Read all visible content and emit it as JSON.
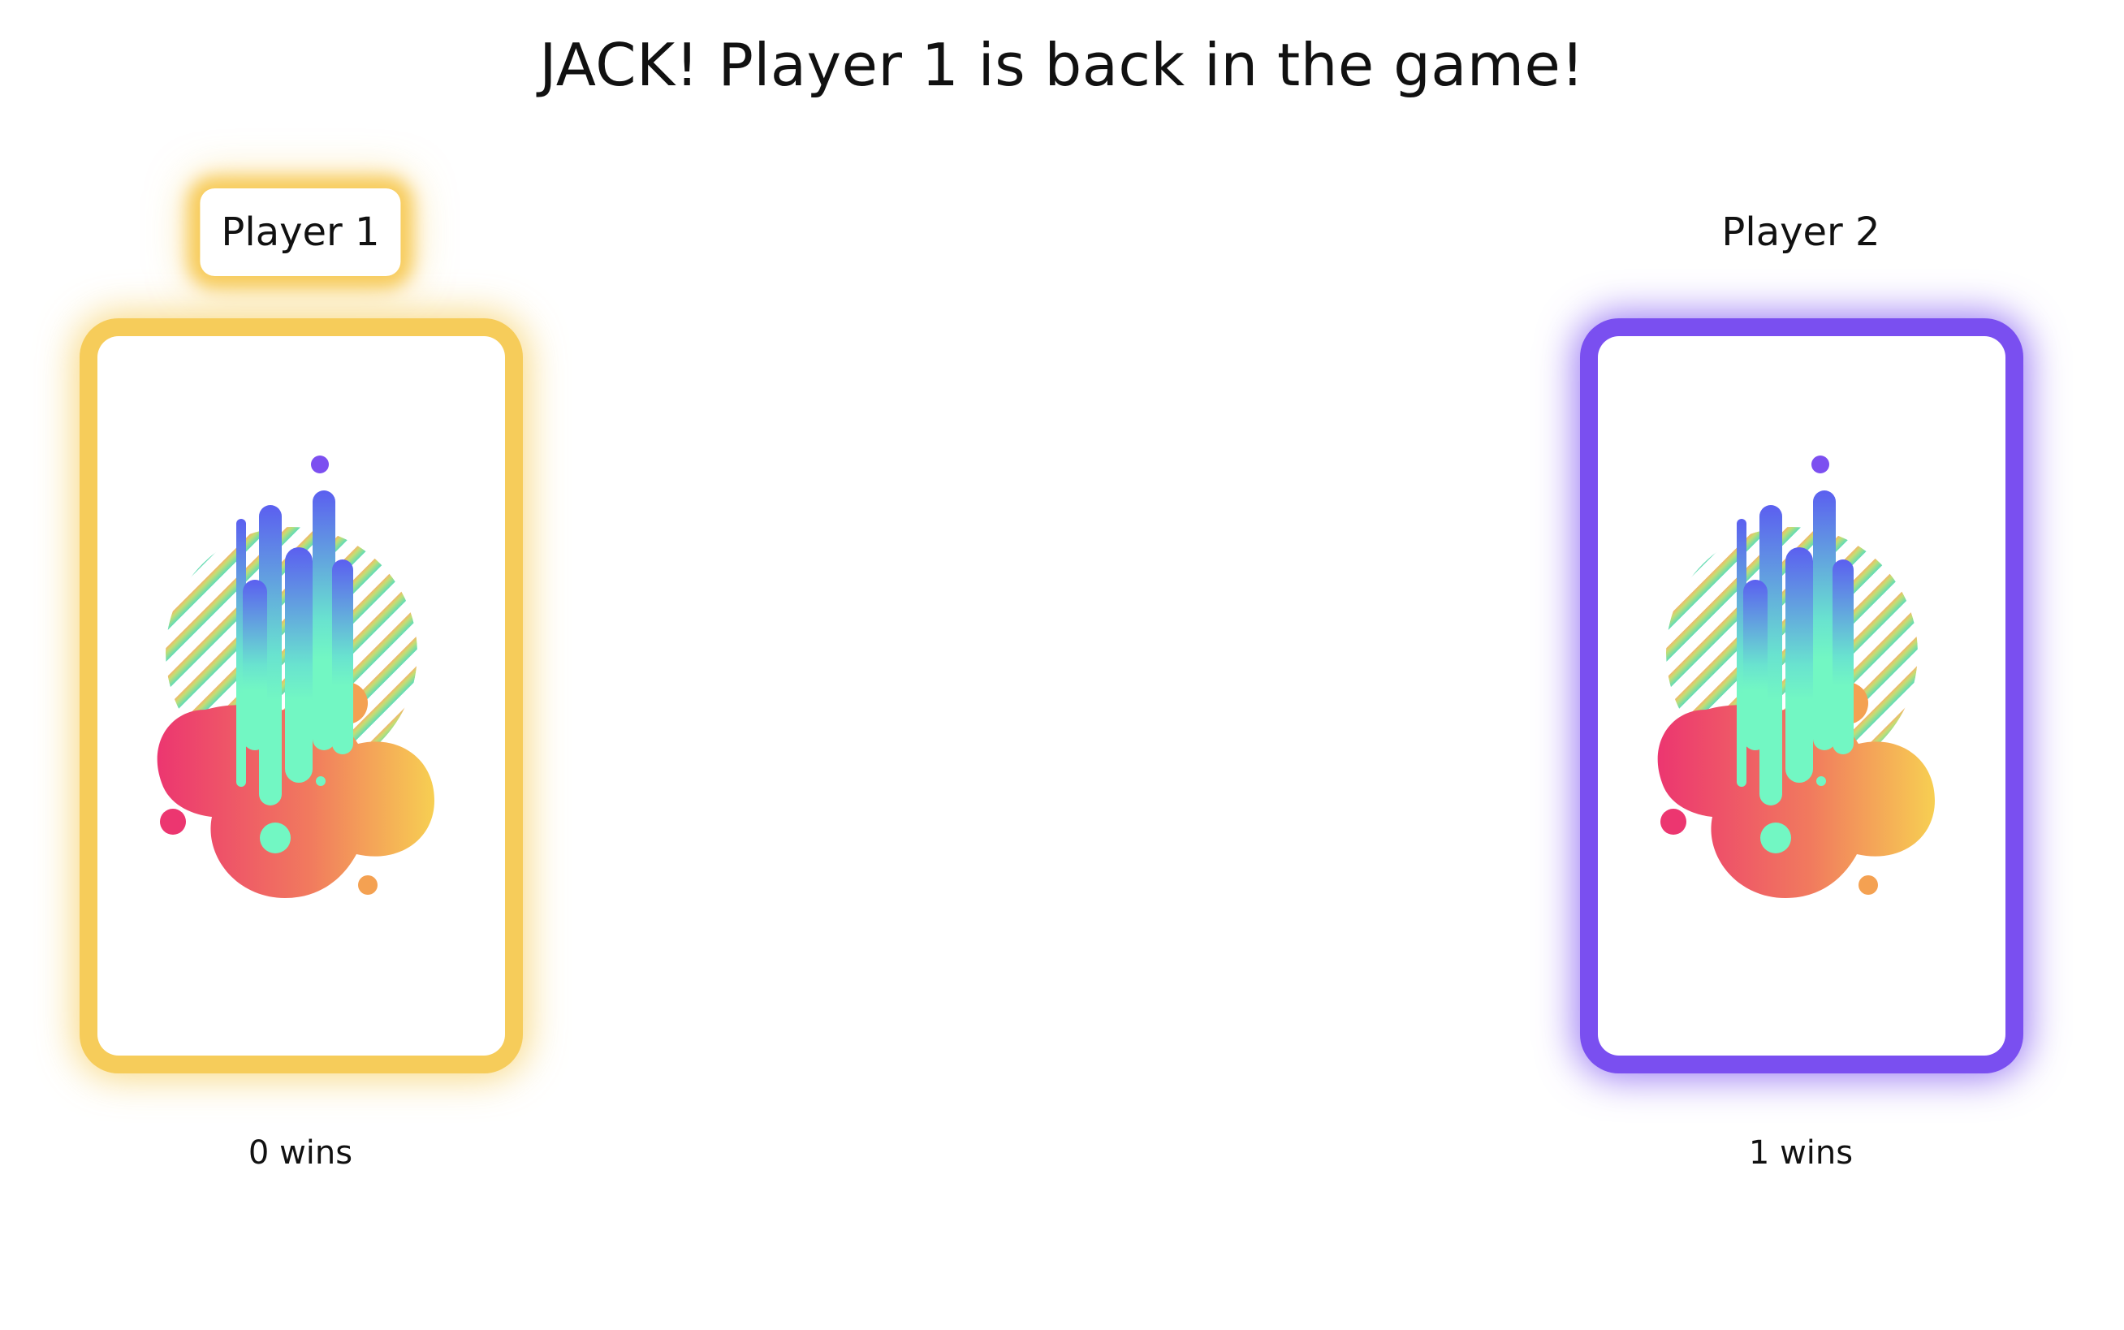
{
  "message": "JACK! Player 1 is back in the game!",
  "players": [
    {
      "name": "Player 1",
      "wins_text": "0 wins",
      "active": true,
      "glow_color": "#f6cc5a"
    },
    {
      "name": "Player 2",
      "wins_text": "1 wins",
      "active": false,
      "glow_color": "#7a4ff0"
    }
  ],
  "card_back_icon": "abstract-paint-splash-icon",
  "colors": {
    "gold": "#f6cc5a",
    "purple": "#7a4ff0",
    "pink": "#ec3670",
    "mint": "#72f7c3",
    "blue": "#5b5ff0"
  }
}
